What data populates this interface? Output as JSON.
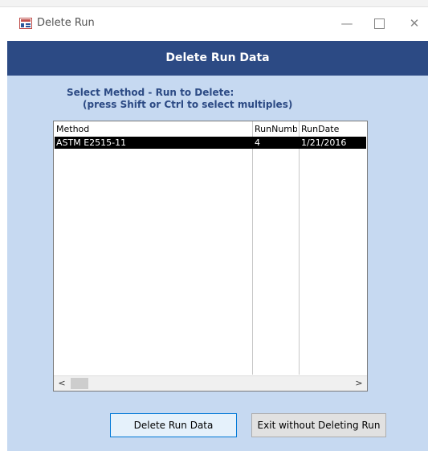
{
  "window": {
    "title": "Delete Run",
    "minimize_glyph": "—",
    "close_glyph": "✕"
  },
  "header": {
    "title": "Delete Run Data"
  },
  "instructions": {
    "line1": "Select Method - Run to Delete:",
    "line2": "(press Shift or Ctrl to select multiples)"
  },
  "list": {
    "columns": [
      "Method",
      "RunNumb",
      "RunDate"
    ],
    "rows": [
      {
        "method": "ASTM E2515-11",
        "run_number": "4",
        "run_date": "1/21/2016",
        "selected": true
      }
    ],
    "scroll_left_glyph": "<",
    "scroll_right_glyph": ">"
  },
  "buttons": {
    "delete": "Delete Run Data",
    "exit": "Exit without Deleting Run"
  },
  "colors": {
    "header_bg": "#2c4a84",
    "form_bg": "#c6d9f1",
    "selected_row_bg": "#000000"
  }
}
